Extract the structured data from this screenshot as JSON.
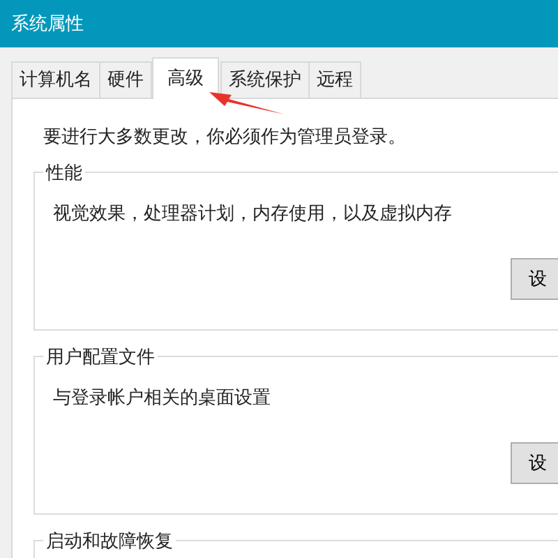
{
  "window": {
    "title": "系统属性"
  },
  "tabs": [
    {
      "label": "计算机名",
      "selected": false
    },
    {
      "label": "硬件",
      "selected": false
    },
    {
      "label": "高级",
      "selected": true
    },
    {
      "label": "系统保护",
      "selected": false
    },
    {
      "label": "远程",
      "selected": false
    }
  ],
  "notice": "要进行大多数更改，你必须作为管理员登录。",
  "groups": [
    {
      "title": "性能",
      "description": "视觉效果，处理器计划，内存使用，以及虚拟内存",
      "button": "设"
    },
    {
      "title": "用户配置文件",
      "description": "与登录帐户相关的桌面设置",
      "button": "设"
    },
    {
      "title": "启动和故障恢复"
    }
  ]
}
